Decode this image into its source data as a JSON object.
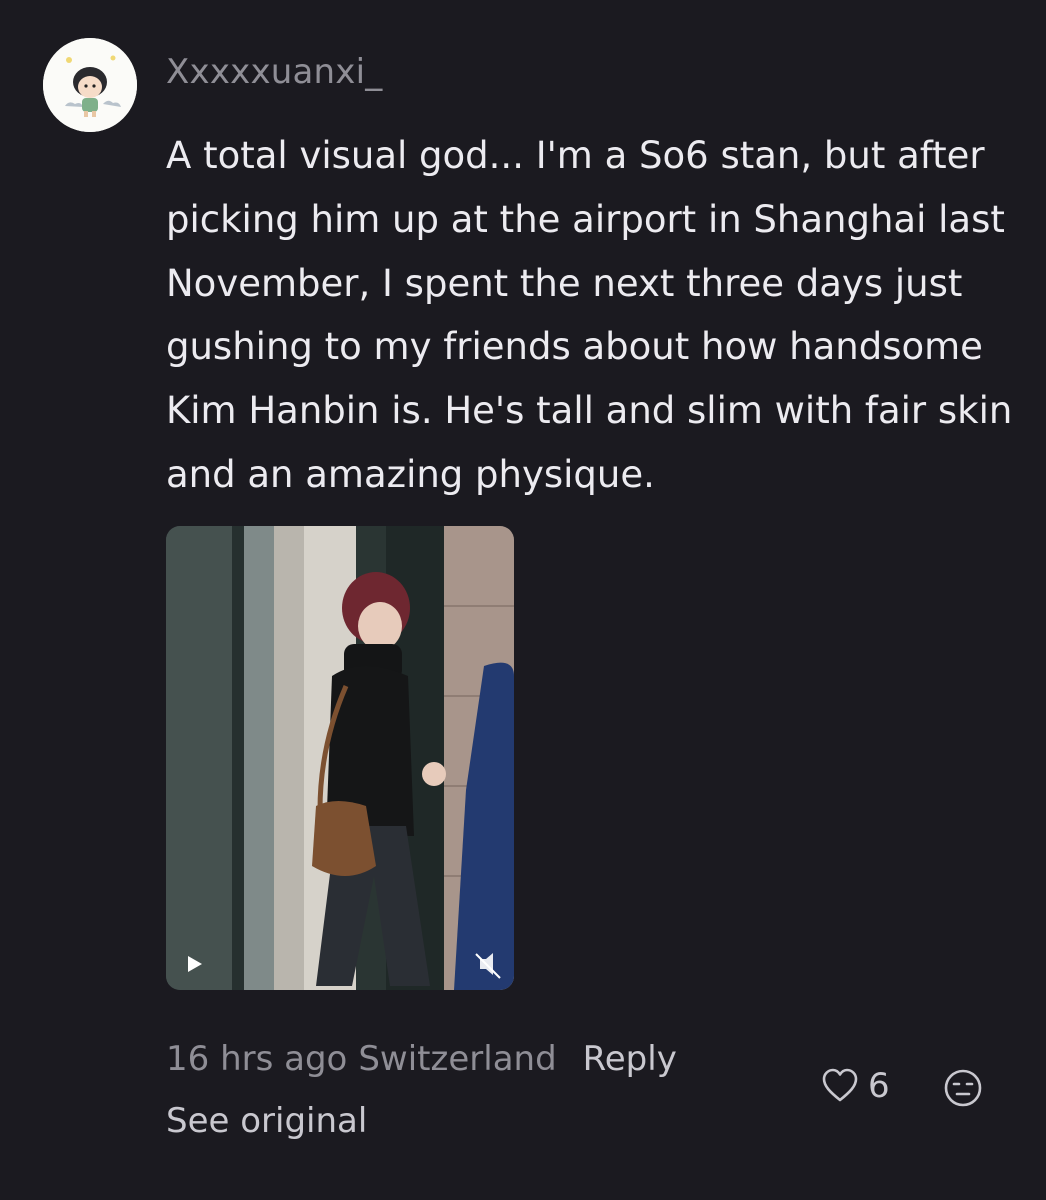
{
  "comment": {
    "username": "Xxxxxuanxi_",
    "text": "A total visual god... I'm a So6 stan, but after picking him up at the airport in Shanghai last November, I spent the next three days just gushing to my friends about how handsome Kim Hanbin is. He's tall and slim with fair skin and an amazing physique.",
    "avatar_icon": "cartoon-avatar-icon",
    "media": {
      "type": "video",
      "play_icon": "play-icon",
      "mute_icon": "muted-speaker-icon"
    },
    "meta": {
      "time": "16 hrs ago",
      "location": "Switzerland",
      "reply_label": "Reply",
      "see_original_label": "See original"
    },
    "likes": {
      "count": "6",
      "icon": "heart-outline-icon"
    },
    "reaction_icon": "emoji-face-icon"
  },
  "colors": {
    "background": "#1b1a20",
    "text_primary": "#ecebf0",
    "text_secondary": "#8f8e96",
    "text_action": "#c9c8cf"
  }
}
